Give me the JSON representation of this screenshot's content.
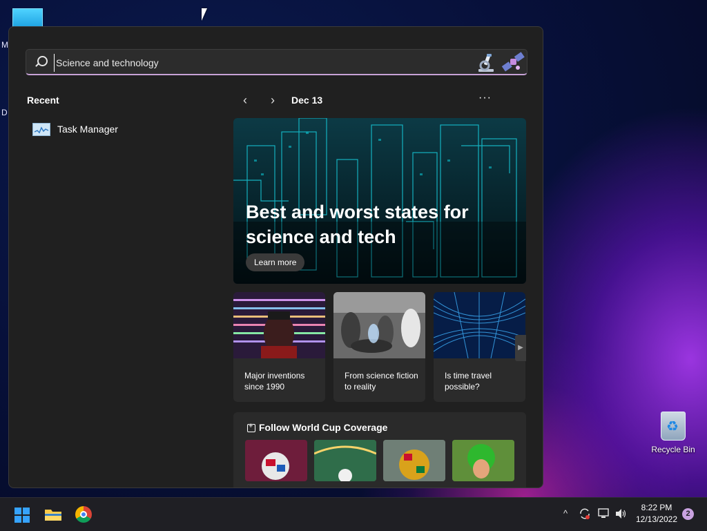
{
  "desktop": {
    "left_letters": [
      "M",
      "D"
    ],
    "recycle_bin_label": "Recycle Bin"
  },
  "widget_panel": {
    "search": {
      "value": "Science and technology"
    },
    "recent": {
      "title": "Recent",
      "items": [
        {
          "label": "Task Manager",
          "icon": "task-manager-icon"
        }
      ]
    },
    "feed": {
      "date": "Dec 13",
      "more_label": "···",
      "hero": {
        "title": "Best and worst states for science and tech",
        "button": "Learn more"
      },
      "cards": [
        {
          "text": "Major inventions since 1990"
        },
        {
          "text": "From science fiction to reality"
        },
        {
          "text": "Is time travel possible?"
        }
      ],
      "world_cup": {
        "title": "Follow World Cup Coverage"
      }
    }
  },
  "taskbar": {
    "clock_time": "8:22 PM",
    "clock_date": "12/13/2022",
    "notification_count": "2"
  },
  "colors": {
    "accent": "#36a3ff",
    "panel_bg": "#202020",
    "search_underline": "#c7a2d6"
  }
}
